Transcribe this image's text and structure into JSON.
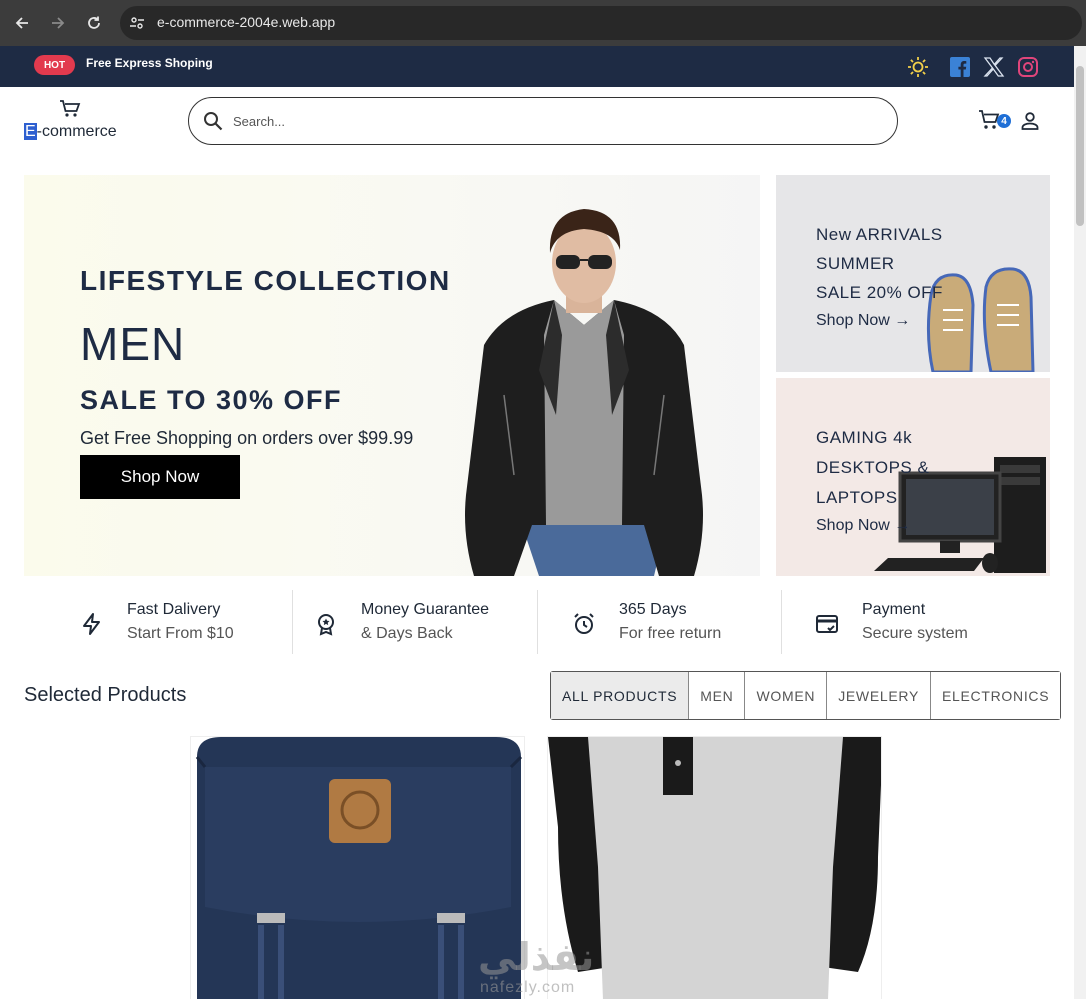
{
  "browser": {
    "url": "e-commerce-2004e.web.app"
  },
  "topbar": {
    "badge": "HOT",
    "promo": "Free Express Shoping",
    "icons": [
      "sun-icon",
      "facebook-icon",
      "x-icon",
      "instagram-icon"
    ]
  },
  "header": {
    "logo_first": "E",
    "logo_rest": "-commerce",
    "search_placeholder": "Search...",
    "cart_count": "4"
  },
  "hero": {
    "kicker": "LIFESTYLE COLLECTION",
    "title": "MEN",
    "sale": "SALE TO 30% OFF",
    "subtitle": "Get Free Shopping on orders over $99.99",
    "button": "Shop Now"
  },
  "promos": [
    {
      "lines": [
        "New ARRIVALS",
        "SUMMER",
        "SALE 20% OFF"
      ],
      "link": "Shop Now →"
    },
    {
      "lines": [
        "GAMING 4k",
        "DESKTOPS &",
        "LAPTOPS"
      ],
      "link": "Shop Now →"
    }
  ],
  "features": [
    {
      "title": "Fast Dalivery",
      "sub": "Start From $10",
      "icon": "lightning-icon"
    },
    {
      "title": "Money Guarantee",
      "sub": "& Days Back",
      "icon": "award-icon"
    },
    {
      "title": "365 Days",
      "sub": "For free return",
      "icon": "alarm-icon"
    },
    {
      "title": "Payment",
      "sub": "Secure system",
      "icon": "card-icon"
    }
  ],
  "products_section": {
    "title": "Selected Products",
    "filters": [
      "ALL PRODUCTS",
      "MEN",
      "WOMEN",
      "JEWELERY",
      "ELECTRONICS"
    ],
    "active_filter": "ALL PRODUCTS"
  },
  "watermark": {
    "arabic": "نفذلي",
    "latin": "nafezly.com"
  },
  "colors": {
    "topbar": "#1e2b44",
    "hot": "#e23a4e",
    "cart_badge": "#1f6fd6",
    "text_dark": "#1e2b44"
  }
}
